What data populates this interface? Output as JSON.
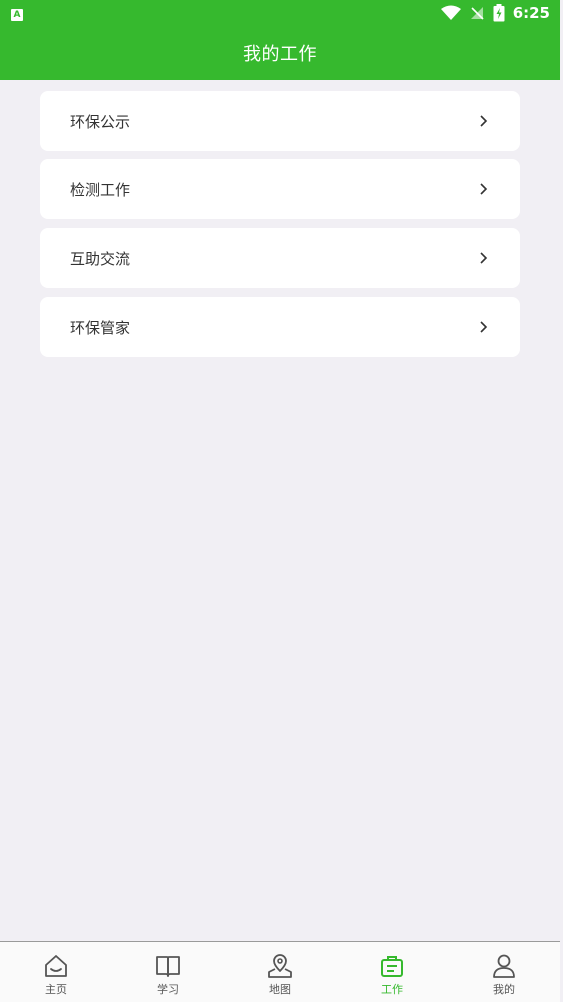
{
  "status_bar": {
    "badge": "A",
    "time": "6:25"
  },
  "header": {
    "title": "我的工作"
  },
  "menu": {
    "items": [
      {
        "label": "环保公示"
      },
      {
        "label": "检测工作"
      },
      {
        "label": "互助交流"
      },
      {
        "label": "环保管家"
      }
    ]
  },
  "bottom_nav": {
    "items": [
      {
        "label": "主页",
        "icon": "home-icon"
      },
      {
        "label": "学习",
        "icon": "book-icon"
      },
      {
        "label": "地图",
        "icon": "map-pin-icon"
      },
      {
        "label": "工作",
        "icon": "briefcase-icon"
      },
      {
        "label": "我的",
        "icon": "user-icon"
      }
    ],
    "active": "工作"
  },
  "colors": {
    "brand_green": "#36b92e",
    "background": "#f1eff4",
    "card": "#ffffff",
    "nav_inactive": "#555555"
  }
}
